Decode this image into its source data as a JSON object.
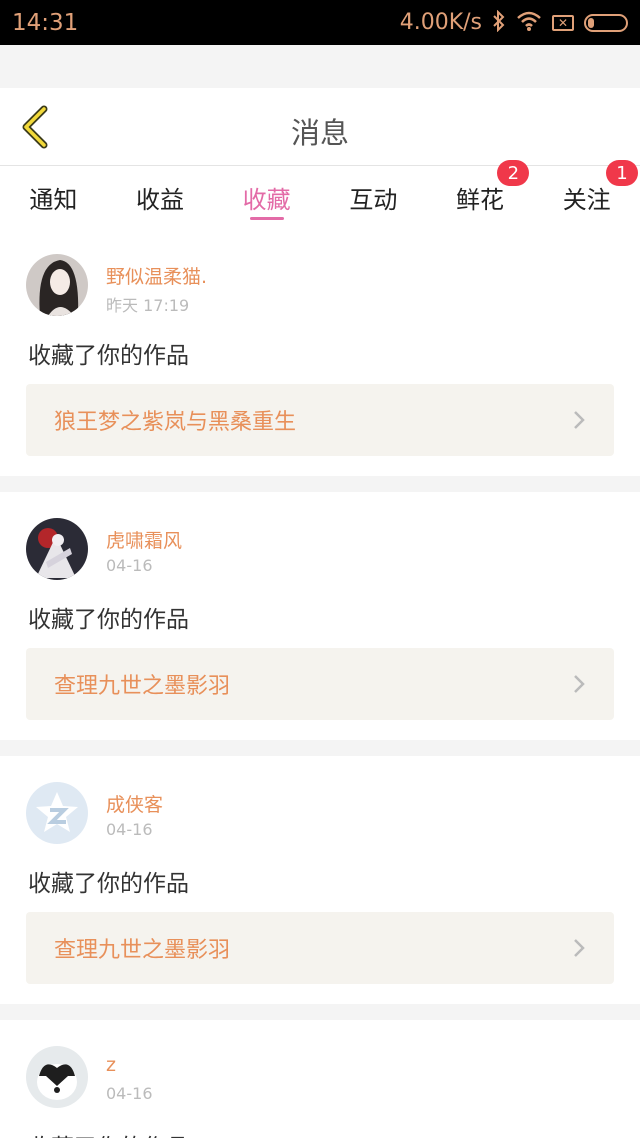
{
  "status_bar": {
    "time": "14:31",
    "net_speed": "4.00K/s",
    "icons": [
      "bluetooth-icon",
      "wifi-icon",
      "sim-icon",
      "battery-icon"
    ],
    "color": "#e0a078"
  },
  "header": {
    "back_icon": "chevron-left-icon",
    "title": "消息"
  },
  "tabs": [
    {
      "label": "通知",
      "badge": null
    },
    {
      "label": "收益",
      "badge": null
    },
    {
      "label": "收藏",
      "badge": null,
      "active": true
    },
    {
      "label": "互动",
      "badge": null
    },
    {
      "label": "鲜花",
      "badge": "2"
    },
    {
      "label": "关注",
      "badge": "1"
    }
  ],
  "colors": {
    "accent_pink": "#e36ba7",
    "name_orange": "#e8905a",
    "badge_red": "#f0384a"
  },
  "messages": [
    {
      "user": "野似温柔猫.",
      "time": "昨天 17:19",
      "action": "收藏了你的作品",
      "work": "狼王梦之紫岚与黑桑重生"
    },
    {
      "user": "虎啸霜风",
      "time": "04-16",
      "action": "收藏了你的作品",
      "work": "查理九世之墨影羽"
    },
    {
      "user": "成侠客",
      "time": "04-16",
      "action": "收藏了你的作品",
      "work": "查理九世之墨影羽"
    },
    {
      "user": "z",
      "time": "04-16",
      "action": "收藏了你的作品",
      "work": ""
    }
  ]
}
